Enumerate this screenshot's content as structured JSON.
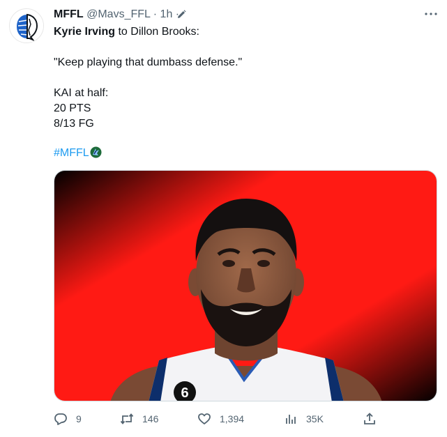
{
  "author": {
    "name": "MFFL",
    "handle": "@Mavs_FFL",
    "separator1": " · ",
    "time": "1h",
    "separator2": " ·"
  },
  "tweet": {
    "line1_bold": "Kyrie Irving",
    "line1_rest": " to Dillon Brooks:",
    "quote": "\"Keep playing that dumbass defense.\"",
    "stat_header": "KAI at half:",
    "stat_pts": "20 PTS",
    "stat_fg": "8/13 FG",
    "hashtag": "#MFFL"
  },
  "media": {
    "subject": "player-portrait",
    "jersey_number": "6",
    "gradient_colors": [
      "#000000",
      "#ff1a14",
      "#ff1a14",
      "#000000"
    ]
  },
  "actions": {
    "replies": "9",
    "retweets": "146",
    "likes": "1,394",
    "views": "35K"
  },
  "icons": [
    "reply-icon",
    "retweet-icon",
    "like-icon",
    "views-icon",
    "share-icon",
    "more-icon",
    "edit-icon"
  ],
  "colors": {
    "text": "#0f1419",
    "secondary": "#536471",
    "link": "#1d9bf0"
  }
}
